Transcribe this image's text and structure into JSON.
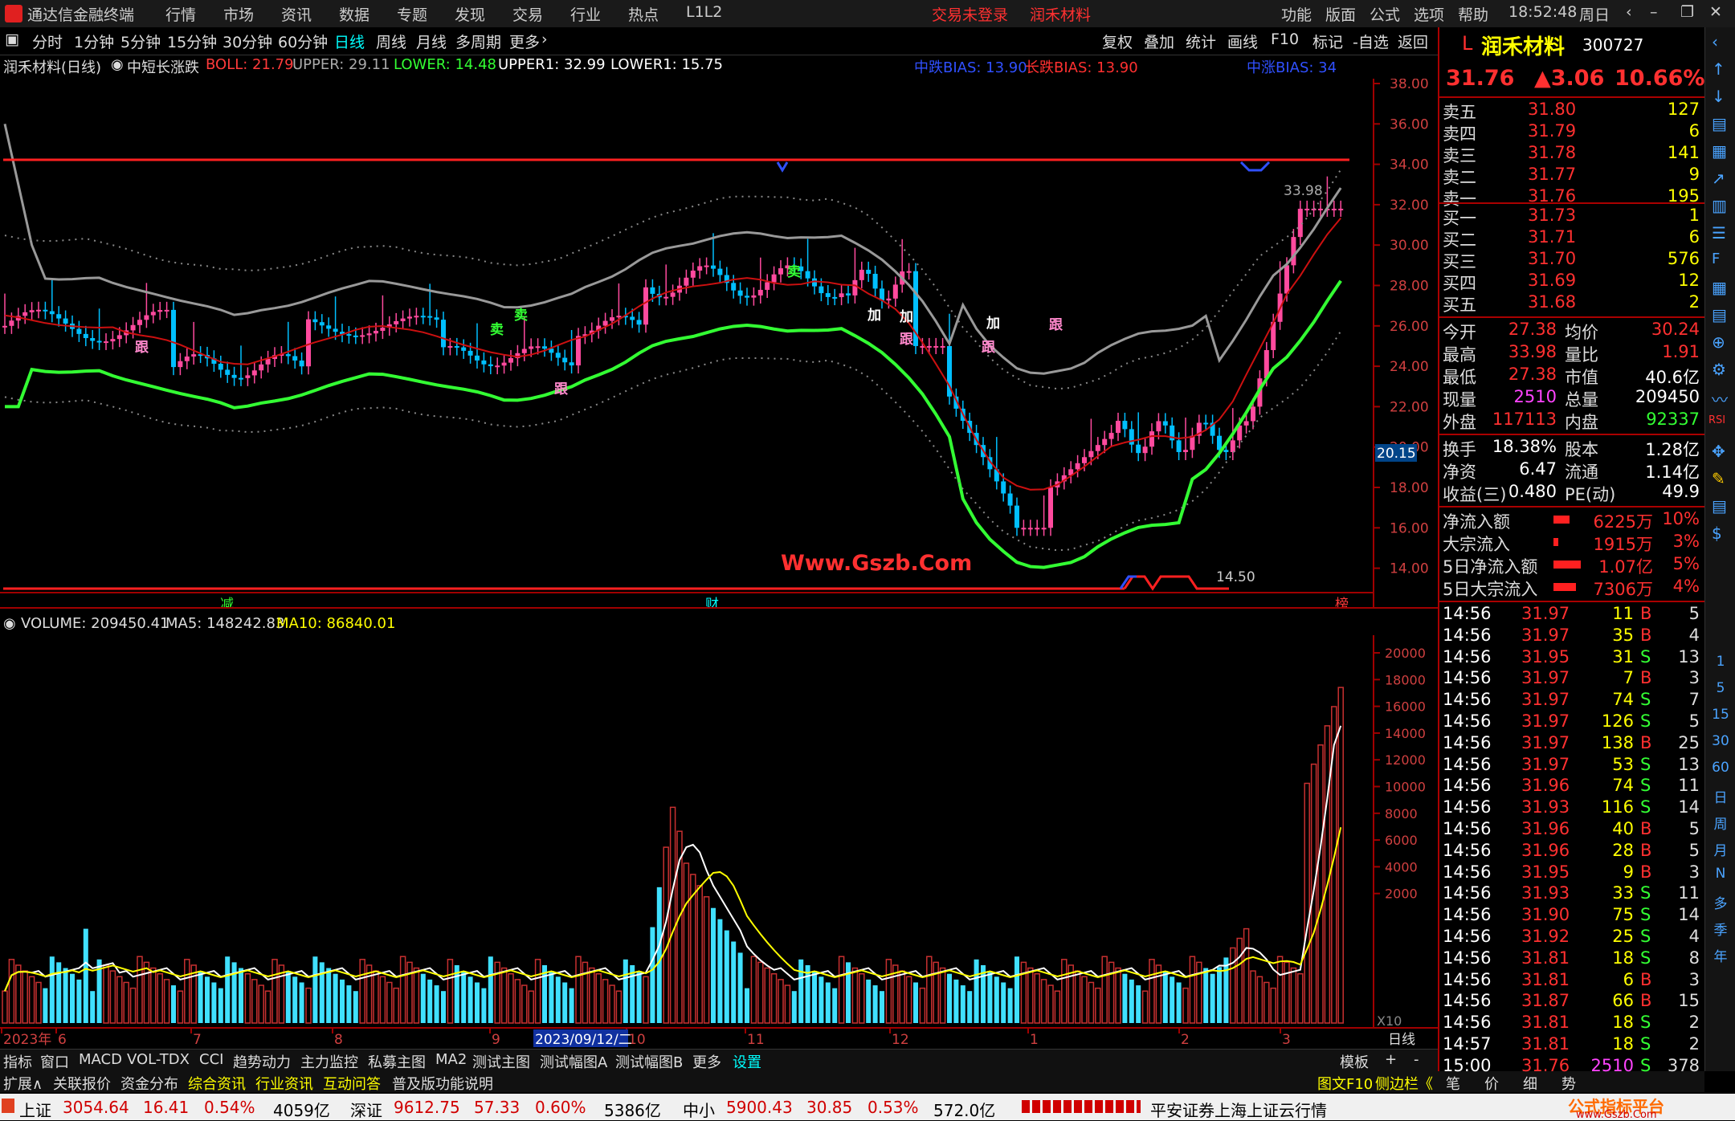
{
  "titlebar": {
    "app_name": "通达信金融终端",
    "menus": [
      "行情",
      "市场",
      "资讯",
      "数据",
      "专题",
      "发现",
      "交易",
      "行业",
      "热点",
      "L1L2"
    ],
    "login_status": "交易未登录",
    "stock_title": "润禾材料",
    "right_menus": [
      "功能",
      "版面",
      "公式",
      "选项",
      "帮助"
    ],
    "time": "18:52:48",
    "weekday": "周日"
  },
  "period_tabs": [
    "分时",
    "1分钟",
    "5分钟",
    "15分钟",
    "30分钟",
    "60分钟",
    "日线",
    "周线",
    "月线",
    "多周期",
    "更多"
  ],
  "active_period": "日线",
  "chart_tools": [
    "复权",
    "叠加",
    "统计",
    "画线",
    "F10",
    "标记",
    "-自选",
    "返回"
  ],
  "main_indicator": {
    "name": "润禾材料(日线)",
    "formula": "中短长涨跌",
    "boll": "BOLL: 21.79",
    "upper": "UPPER: 29.11",
    "lower": "LOWER: 14.48",
    "upper1": "UPPER1: 32.99",
    "lower1": "LOWER1: 15.75",
    "bias_mid": "中跌BIAS: 13.90",
    "bias_long": "长跌BIAS: 13.90",
    "bias_mid_up": "中涨BIAS: 34"
  },
  "price_axis": [
    "38.00",
    "36.00",
    "34.00",
    "32.00",
    "30.00",
    "28.00",
    "26.00",
    "24.00",
    "22.00",
    "20.00",
    "18.00",
    "16.00",
    "14.00"
  ],
  "crosshair_price": "20.15",
  "high_label": "33.98",
  "low_label": "14.50",
  "watermark": "Www.Gszb.Com",
  "signal_labels": {
    "sell": "卖",
    "follow": "跟",
    "add": "加",
    "reduce": "减",
    "finance": "财",
    "rank": "榜"
  },
  "volume_indicator": {
    "volume": "VOLUME: 209450.41",
    "ma5": "MA5: 148242.83",
    "ma10": "MA10: 86840.01"
  },
  "volume_axis": [
    "20000",
    "18000",
    "16000",
    "14000",
    "12000",
    "10000",
    "8000",
    "6000",
    "4000",
    "2000"
  ],
  "volume_multiplier": "X10",
  "date_axis": [
    "2023年",
    "6",
    "7",
    "8",
    "9",
    "10",
    "11",
    "12",
    "1",
    "2",
    "3"
  ],
  "date_highlight": "2023/09/12/二",
  "date_axis_mode": "日线",
  "bottom_tabs": [
    "指标",
    "窗口",
    "MACD",
    "VOL-TDX",
    "CCI",
    "趋势动力",
    "主力监控",
    "私募主图",
    "MA2",
    "测试主图",
    "测试幅图A",
    "测试幅图B",
    "更多",
    "设置"
  ],
  "bottom_right": [
    "模板",
    "+",
    "-"
  ],
  "bottom_tabs2": [
    "扩展∧",
    "关联报价",
    "资金分布",
    "综合资讯",
    "行业资讯",
    "互动问答",
    "普及版功能说明"
  ],
  "bottom_tabs2_right": [
    "图文F10",
    "侧边栏《",
    "笔",
    "价",
    "细",
    "势"
  ],
  "quote": {
    "marker": "L",
    "name": "润禾材料",
    "code": "300727",
    "price": "31.76",
    "change": "▲3.06",
    "pct": "10.66%",
    "asks": [
      {
        "label": "卖五",
        "price": "31.80",
        "vol": "127"
      },
      {
        "label": "卖四",
        "price": "31.79",
        "vol": "6"
      },
      {
        "label": "卖三",
        "price": "31.78",
        "vol": "141"
      },
      {
        "label": "卖二",
        "price": "31.77",
        "vol": "9"
      },
      {
        "label": "卖一",
        "price": "31.76",
        "vol": "195"
      }
    ],
    "bids": [
      {
        "label": "买一",
        "price": "31.73",
        "vol": "1"
      },
      {
        "label": "买二",
        "price": "31.71",
        "vol": "6"
      },
      {
        "label": "买三",
        "price": "31.70",
        "vol": "576"
      },
      {
        "label": "买四",
        "price": "31.69",
        "vol": "12"
      },
      {
        "label": "买五",
        "price": "31.68",
        "vol": "2"
      }
    ],
    "stats": [
      {
        "l1": "今开",
        "v1": "27.38",
        "l2": "均价",
        "v2": "30.24"
      },
      {
        "l1": "最高",
        "v1": "33.98",
        "l2": "量比",
        "v2": "1.91"
      },
      {
        "l1": "最低",
        "v1": "27.38",
        "l2": "市值",
        "v2": "40.6亿"
      },
      {
        "l1": "现量",
        "v1": "2510",
        "l2": "总量",
        "v2": "209450"
      },
      {
        "l1": "外盘",
        "v1": "117113",
        "l2": "内盘",
        "v2": "92337"
      }
    ],
    "stats2": [
      {
        "l1": "换手",
        "v1": "18.38%",
        "l2": "股本",
        "v2": "1.28亿"
      },
      {
        "l1": "净资",
        "v1": "6.47",
        "l2": "流通",
        "v2": "1.14亿"
      },
      {
        "l1": "收益(三)",
        "v1": "0.480",
        "l2": "PE(动)",
        "v2": "49.9"
      }
    ],
    "flows": [
      {
        "label": "净流入额",
        "value": "6225万",
        "pct": "10%"
      },
      {
        "label": "大宗流入",
        "value": "1915万",
        "pct": "3%"
      },
      {
        "label": "5日净流入额",
        "value": "1.07亿",
        "pct": "5%"
      },
      {
        "label": "5日大宗流入",
        "value": "7306万",
        "pct": "4%"
      }
    ],
    "ticks": [
      {
        "t": "14:56",
        "p": "31.97",
        "v": "11",
        "d": "B",
        "n": "5"
      },
      {
        "t": "14:56",
        "p": "31.97",
        "v": "35",
        "d": "B",
        "n": "4"
      },
      {
        "t": "14:56",
        "p": "31.95",
        "v": "31",
        "d": "S",
        "n": "13"
      },
      {
        "t": "14:56",
        "p": "31.97",
        "v": "7",
        "d": "B",
        "n": "3"
      },
      {
        "t": "14:56",
        "p": "31.97",
        "v": "74",
        "d": "S",
        "n": "7"
      },
      {
        "t": "14:56",
        "p": "31.97",
        "v": "126",
        "d": "S",
        "n": "5"
      },
      {
        "t": "14:56",
        "p": "31.97",
        "v": "138",
        "d": "B",
        "n": "25"
      },
      {
        "t": "14:56",
        "p": "31.97",
        "v": "53",
        "d": "S",
        "n": "13"
      },
      {
        "t": "14:56",
        "p": "31.96",
        "v": "74",
        "d": "S",
        "n": "11"
      },
      {
        "t": "14:56",
        "p": "31.93",
        "v": "116",
        "d": "S",
        "n": "14"
      },
      {
        "t": "14:56",
        "p": "31.96",
        "v": "40",
        "d": "B",
        "n": "5"
      },
      {
        "t": "14:56",
        "p": "31.96",
        "v": "28",
        "d": "B",
        "n": "5"
      },
      {
        "t": "14:56",
        "p": "31.95",
        "v": "9",
        "d": "B",
        "n": "3"
      },
      {
        "t": "14:56",
        "p": "31.93",
        "v": "33",
        "d": "S",
        "n": "11"
      },
      {
        "t": "14:56",
        "p": "31.90",
        "v": "75",
        "d": "S",
        "n": "14"
      },
      {
        "t": "14:56",
        "p": "31.92",
        "v": "25",
        "d": "S",
        "n": "4"
      },
      {
        "t": "14:56",
        "p": "31.81",
        "v": "18",
        "d": "S",
        "n": "8"
      },
      {
        "t": "14:56",
        "p": "31.81",
        "v": "6",
        "d": "B",
        "n": "3"
      },
      {
        "t": "14:56",
        "p": "31.87",
        "v": "66",
        "d": "B",
        "n": "15"
      },
      {
        "t": "14:56",
        "p": "31.81",
        "v": "18",
        "d": "S",
        "n": "2"
      },
      {
        "t": "14:57",
        "p": "31.81",
        "v": "18",
        "d": "S",
        "n": "2"
      },
      {
        "t": "15:00",
        "p": "31.76",
        "v": "2510",
        "d": "S",
        "n": "378"
      }
    ]
  },
  "side_icons": [
    "1",
    "5",
    "15",
    "30",
    "60",
    "日",
    "周",
    "月",
    "N",
    "多",
    "季",
    "年"
  ],
  "statusbar": {
    "sh_label": "上证",
    "sh_value": "3054.64",
    "sh_change": "16.41",
    "sh_pct": "0.54%",
    "sh_amt": "4059亿",
    "sz_label": "深证",
    "sz_value": "9612.75",
    "sz_change": "57.33",
    "sz_pct": "0.60%",
    "sz_amt": "5386亿",
    "zx_label": "中小",
    "zx_value": "5900.43",
    "zx_change": "30.85",
    "zx_pct": "0.53%",
    "zx_amt": "572.0亿",
    "broker": "平安证券上海上证云行情",
    "brand": "公式指标平台",
    "brand_url": "www.Gszb.Com"
  },
  "colors": {
    "up": "#ff3b3b",
    "down": "#00ffff",
    "bg": "#000000",
    "grid": "#a00000",
    "green_line": "#33ff33",
    "yellow": "#ffff00"
  }
}
